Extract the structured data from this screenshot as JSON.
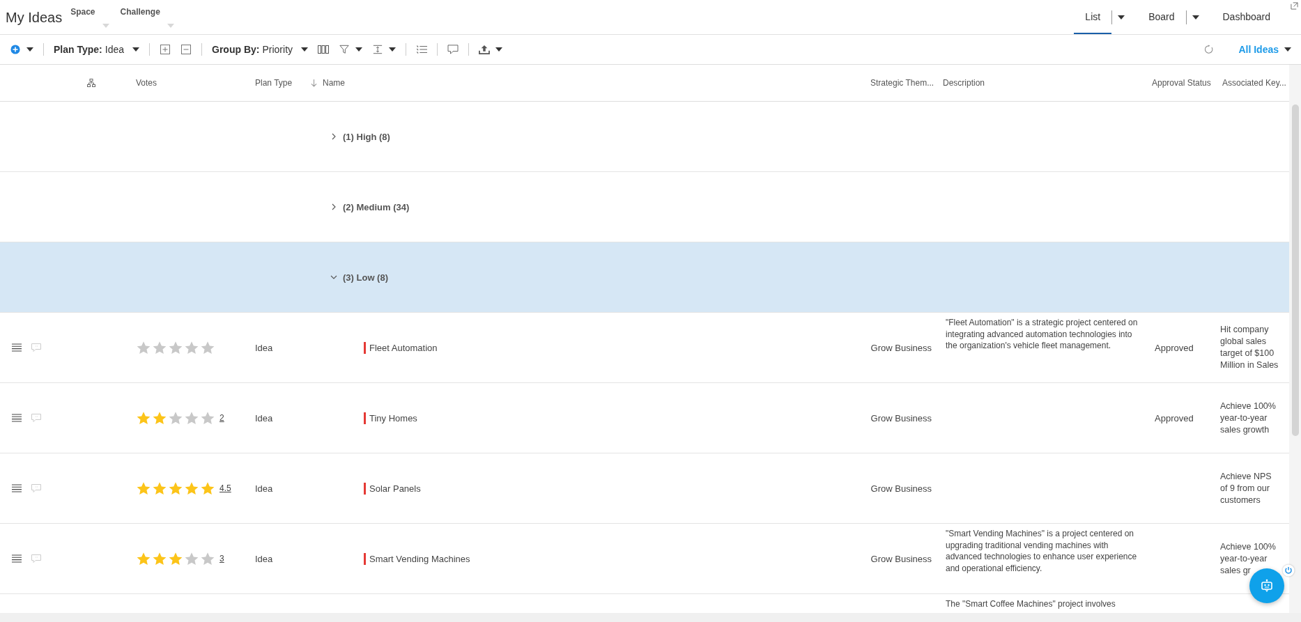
{
  "header": {
    "title": "My Ideas",
    "filters": [
      {
        "label": "Space"
      },
      {
        "label": "Challenge"
      }
    ],
    "views": [
      {
        "label": "List",
        "selected": true,
        "has_menu": true
      },
      {
        "label": "Board",
        "selected": false,
        "has_menu": true
      },
      {
        "label": "Dashboard",
        "selected": false,
        "has_menu": false
      }
    ]
  },
  "toolbar": {
    "plan_type": {
      "label": "Plan Type:",
      "value": "Idea"
    },
    "group_by": {
      "label": "Group By:",
      "value": "Priority"
    },
    "view_filter": "All Ideas"
  },
  "table": {
    "columns": [
      {
        "label": "Votes",
        "sorted": false
      },
      {
        "label": "Plan Type",
        "sorted": false
      },
      {
        "label": "Name",
        "sorted": true
      },
      {
        "label": "Strategic Them...",
        "sorted": false
      },
      {
        "label": "Description",
        "sorted": false
      },
      {
        "label": "Approval Status",
        "sorted": false
      },
      {
        "label": "Associated Key...",
        "sorted": false
      }
    ],
    "groups": [
      {
        "label": "(1) High (8)",
        "expanded": false,
        "selected": false
      },
      {
        "label": "(2) Medium (34)",
        "expanded": false,
        "selected": false
      },
      {
        "label": "(3) Low (8)",
        "expanded": true,
        "selected": true
      }
    ],
    "rows": [
      {
        "stars": 0,
        "plan_type": "Idea",
        "name": "Fleet Automation",
        "theme": "Grow Business",
        "description": "\"Fleet Automation\" is a strategic project centered on integrating advanced automation technologies into the organization's vehicle fleet management.",
        "approval": "Approved",
        "key_result": "Hit company global sales target of $100 Million in Sales"
      },
      {
        "stars": 2,
        "vote_count": "2",
        "plan_type": "Idea",
        "name": "Tiny Homes",
        "theme": "Grow Business",
        "approval": "Approved",
        "key_result": "Achieve 100% year-to-year sales growth"
      },
      {
        "stars": 5,
        "vote_count": "4.5",
        "plan_type": "Idea",
        "name": "Solar Panels",
        "theme": "Grow Business",
        "key_result": "Achieve NPS of 9 from our customers"
      },
      {
        "stars": 3,
        "vote_count": "3",
        "plan_type": "Idea",
        "name": "Smart Vending Machines",
        "theme": "Grow Business",
        "description": "\"Smart Vending Machines\" is a project centered on upgrading traditional vending machines with advanced technologies to enhance user experience and operational efficiency.",
        "key_result": "Achieve 100% year-to-year sales gr"
      },
      {
        "description": "The \"Smart Coffee Machines\" project involves"
      }
    ]
  }
}
